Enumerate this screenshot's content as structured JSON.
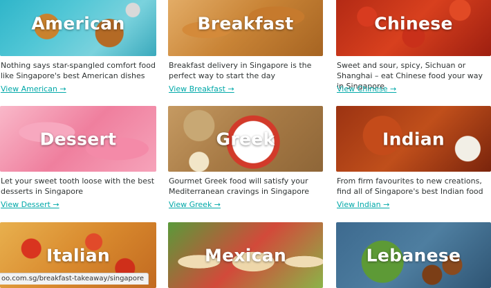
{
  "cuisines": [
    {
      "name": "American",
      "desc": "Nothing says star-spangled comfort food like Singapore's best American dishes",
      "link": "View American →",
      "color": "#2bb3c8"
    },
    {
      "name": "Breakfast",
      "desc": "Breakfast delivery in Singapore is the perfect way to start the day",
      "link": "View Breakfast →",
      "color": "#c98436"
    },
    {
      "name": "Chinese",
      "desc": "Sweet and sour, spicy, Sichuan or Shanghai – eat Chinese food your way in Singapore",
      "link": "View Chinese →",
      "color": "#d8401e"
    },
    {
      "name": "Dessert",
      "desc": "Let your sweet tooth loose with the best desserts in Singapore",
      "link": "View Dessert →",
      "color": "#ef7f9e"
    },
    {
      "name": "Greek",
      "desc": "Gourmet Greek food will satisfy your Mediterranean cravings in Singapore",
      "link": "View Greek →",
      "color": "#a77a45"
    },
    {
      "name": "Indian",
      "desc": "From firm favourites to new creations, find all of Singapore's best Indian food",
      "link": "View Indian →",
      "color": "#c04f1b"
    },
    {
      "name": "Italian",
      "desc": "",
      "link": "",
      "color": "#d98a2e"
    },
    {
      "name": "Mexican",
      "desc": "",
      "link": "",
      "color": "#5a9a3a"
    },
    {
      "name": "Lebanese",
      "desc": "",
      "link": "",
      "color": "#4e7ea0"
    }
  ],
  "status_bar": {
    "url": "oo.com.sg/breakfast-takeaway/singapore"
  },
  "theme": {
    "link_color": "#00a8a8",
    "text_color": "#2e3333"
  }
}
